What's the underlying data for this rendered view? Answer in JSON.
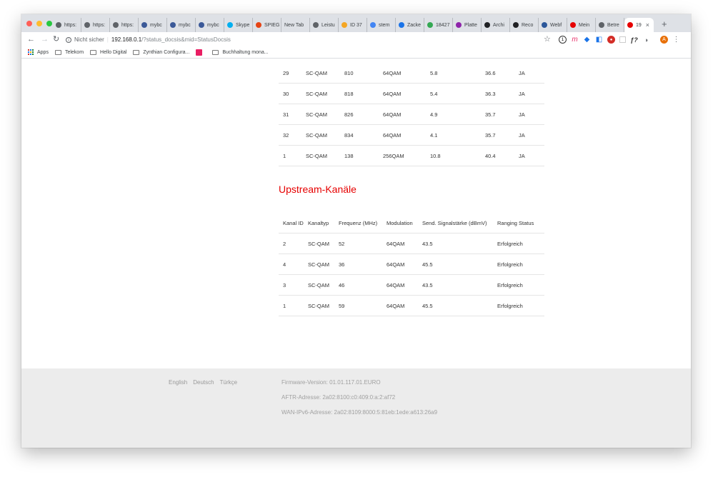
{
  "browser": {
    "tabs": [
      {
        "label": "https:",
        "icon": "globe-icon",
        "color": "#5f6368"
      },
      {
        "label": "https:",
        "icon": "globe-icon",
        "color": "#5f6368"
      },
      {
        "label": "https:",
        "icon": "globe-icon",
        "color": "#5f6368"
      },
      {
        "label": "mybc",
        "icon": "page-icon",
        "color": "#3b5998"
      },
      {
        "label": "mybc",
        "icon": "page-icon",
        "color": "#3b5998"
      },
      {
        "label": "mybc",
        "icon": "page-icon",
        "color": "#3b5998"
      },
      {
        "label": "Skype",
        "icon": "skype-icon",
        "color": "#00aff0"
      },
      {
        "label": "SPIEG",
        "icon": "spiegel-icon",
        "color": "#e64415"
      },
      {
        "label": "New Tab",
        "icon": "",
        "color": ""
      },
      {
        "label": "Leistu",
        "icon": "link-icon",
        "color": "#5f6368"
      },
      {
        "label": "ID 37",
        "icon": "id-icon",
        "color": "#f5a623"
      },
      {
        "label": "stern",
        "icon": "google-icon",
        "color": "#4285f4"
      },
      {
        "label": "Zacke",
        "icon": "crown-icon",
        "color": "#1a73e8"
      },
      {
        "label": "18427",
        "icon": "check-icon",
        "color": "#34a853"
      },
      {
        "label": "Platte",
        "icon": "platte-icon",
        "color": "#8e24aa"
      },
      {
        "label": "Archi",
        "icon": "archive-icon",
        "color": "#202124"
      },
      {
        "label": "Reco",
        "icon": "infinity-icon",
        "color": "#202124"
      },
      {
        "label": "Webf",
        "icon": "word-icon",
        "color": "#2b579a"
      },
      {
        "label": "Mein",
        "icon": "vodafone-icon",
        "color": "#e60000"
      },
      {
        "label": "Betre",
        "icon": "globe-icon",
        "color": "#5f6368"
      },
      {
        "label": "19",
        "icon": "vodafone-icon",
        "color": "#e60000"
      }
    ],
    "address": {
      "security_label": "Nicht sicher",
      "host": "192.168.0.1",
      "path": "/?status_docsis&mid=StatusDocsis"
    },
    "bookmarks": [
      {
        "label": "Apps",
        "icon": "apps-grid-icon"
      },
      {
        "label": "Telekom",
        "icon": "folder-icon"
      },
      {
        "label": "Hello Digital",
        "icon": "folder-icon"
      },
      {
        "label": "Zynthian Configura...",
        "icon": "zynthian-icon"
      },
      {
        "label": "",
        "icon": "pink-app-icon"
      },
      {
        "label": "Buchhaltung mona...",
        "icon": "folder-icon"
      }
    ]
  },
  "colors": {
    "accent_red": "#e60000",
    "footer_bg": "#ececec",
    "tabstrip_bg": "#dee1e6"
  },
  "downstream": {
    "rows": [
      [
        "29",
        "SC-QAM",
        "810",
        "64QAM",
        "5.8",
        "36.6",
        "JA"
      ],
      [
        "30",
        "SC-QAM",
        "818",
        "64QAM",
        "5.4",
        "36.3",
        "JA"
      ],
      [
        "31",
        "SC-QAM",
        "826",
        "64QAM",
        "4.9",
        "35.7",
        "JA"
      ],
      [
        "32",
        "SC-QAM",
        "834",
        "64QAM",
        "4.1",
        "35.7",
        "JA"
      ],
      [
        "1",
        "SC-QAM",
        "138",
        "256QAM",
        "10.8",
        "40.4",
        "JA"
      ]
    ]
  },
  "upstream": {
    "title": "Upstream-Kanäle",
    "headers": [
      "Kanal ID",
      "Kanaltyp",
      "Frequenz (MHz)",
      "Modulation",
      "Send. Signalstärke (dBmV)",
      "Ranging Status"
    ],
    "rows": [
      [
        "2",
        "SC-QAM",
        "52",
        "64QAM",
        "43.5",
        "Erfolgreich"
      ],
      [
        "4",
        "SC-QAM",
        "36",
        "64QAM",
        "45.5",
        "Erfolgreich"
      ],
      [
        "3",
        "SC-QAM",
        "46",
        "64QAM",
        "43.5",
        "Erfolgreich"
      ],
      [
        "1",
        "SC-QAM",
        "59",
        "64QAM",
        "45.5",
        "Erfolgreich"
      ]
    ]
  },
  "footer": {
    "languages": [
      "English",
      "Deutsch",
      "Türkçe"
    ],
    "firmware": "Firmware-Version: 01.01.117.01.EURO",
    "aftr": "AFTR-Adresse: 2a02:8100:c0:409:0:a:2:af72",
    "wan": "WAN-IPv6-Adresse: 2a02:8109:8000:5:81eb:1ede:a613:26a9"
  }
}
